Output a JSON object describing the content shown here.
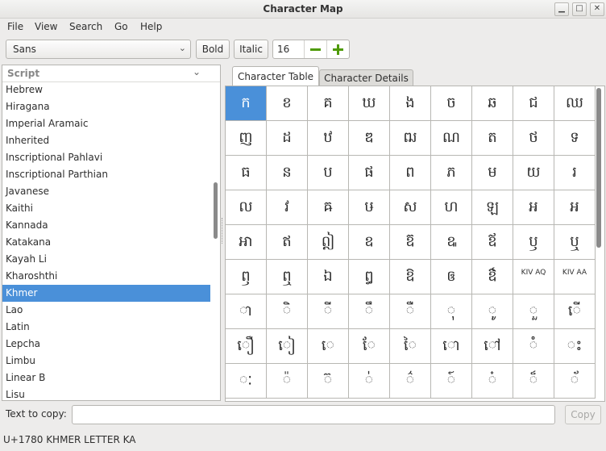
{
  "window": {
    "title": "Character Map"
  },
  "menu": [
    "File",
    "View",
    "Search",
    "Go",
    "Help"
  ],
  "toolbar": {
    "font": "Sans",
    "bold": "Bold",
    "italic": "Italic",
    "size": "16"
  },
  "sidebar": {
    "header": "Script",
    "items": [
      "Hebrew",
      "Hiragana",
      "Imperial Aramaic",
      "Inherited",
      "Inscriptional Pahlavi",
      "Inscriptional Parthian",
      "Javanese",
      "Kaithi",
      "Kannada",
      "Katakana",
      "Kayah Li",
      "Kharoshthi",
      "Khmer",
      "Lao",
      "Latin",
      "Lepcha",
      "Limbu",
      "Linear B",
      "Lisu"
    ],
    "selected": "Khmer"
  },
  "tabs": [
    "Character Table",
    "Character Details"
  ],
  "characters": [
    [
      "ក",
      "ខ",
      "គ",
      "ឃ",
      "ង",
      "ច",
      "ឆ",
      "ជ",
      "ឈ"
    ],
    [
      "ញ",
      "ដ",
      "ឋ",
      "ឌ",
      "ឍ",
      "ណ",
      "ត",
      "ថ",
      "ទ"
    ],
    [
      "ធ",
      "ន",
      "ប",
      "ផ",
      "ព",
      "ភ",
      "ម",
      "យ",
      "រ"
    ],
    [
      "ល",
      "វ",
      "ឝ",
      "ឞ",
      "ស",
      "ហ",
      "ឡ",
      "អ",
      "ឣ"
    ],
    [
      "ឤ",
      "ឥ",
      "ឦ",
      "ឧ",
      "ឨ",
      "ឩ",
      "ឪ",
      "ឫ",
      "ឬ"
    ],
    [
      "ឭ",
      "ឮ",
      "ឯ",
      "ឰ",
      "ឱ",
      "ឲ",
      "ឳ",
      "KIV AQ",
      "KIV AA"
    ],
    [
      "ា",
      "ិ",
      "ី",
      "ឹ",
      "ឺ",
      "ុ",
      "ូ",
      "ួ",
      "ើ"
    ],
    [
      "ឿ",
      "ៀ",
      "េ",
      "ែ",
      "ៃ",
      "ោ",
      "ៅ",
      "ំ",
      "ះ"
    ],
    [
      "ៈ",
      "៉",
      "៊",
      "់",
      "៌",
      "៍",
      "៎",
      "៏",
      "័"
    ]
  ],
  "copy": {
    "label": "Text to copy:",
    "value": "",
    "button": "Copy"
  },
  "status": "U+1780 KHMER LETTER KA"
}
